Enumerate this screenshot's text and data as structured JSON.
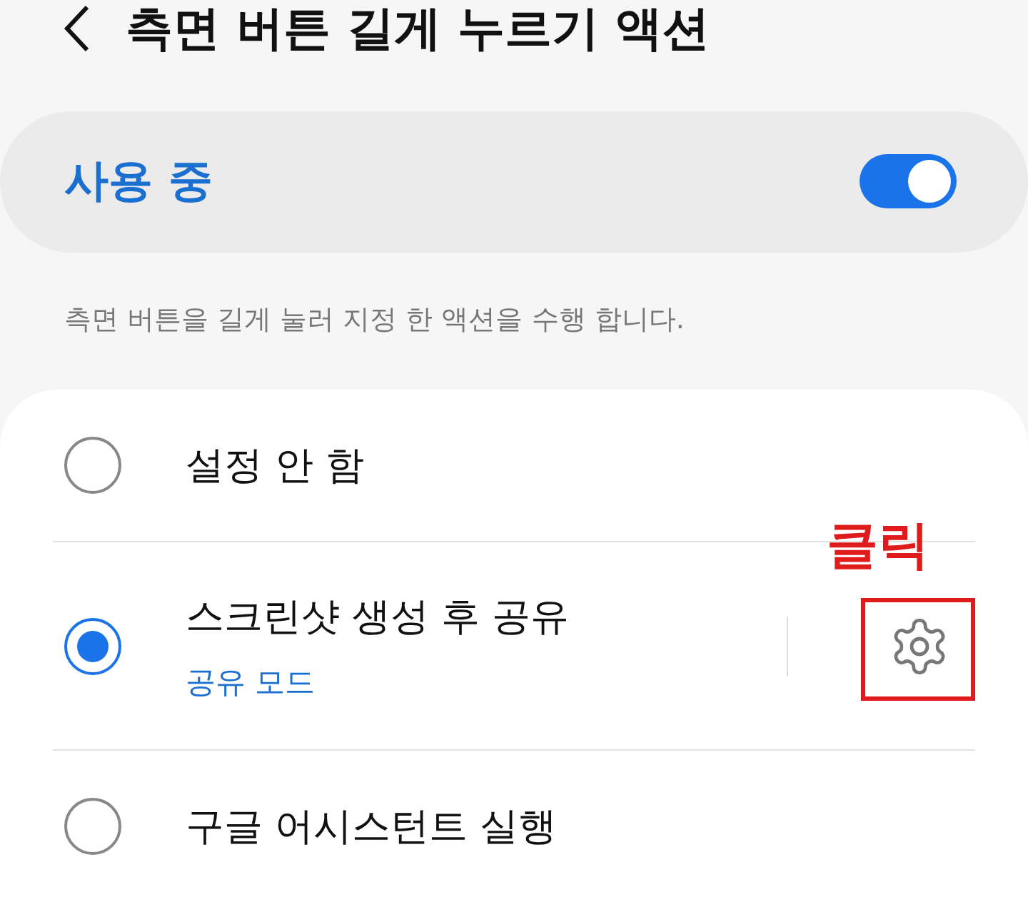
{
  "header": {
    "title": "측면 버튼 길게 누르기 액션"
  },
  "master_switch": {
    "label": "사용 중",
    "on": true
  },
  "description": "측면 버튼을 길게 눌러 지정 한 액션을 수행 합니다.",
  "options": [
    {
      "label": "설정 안 함",
      "selected": false
    },
    {
      "label": "스크린샷 생성 후 공유",
      "subtitle": "공유 모드",
      "selected": true,
      "has_settings": true
    },
    {
      "label": "구글 어시스턴트 실행",
      "selected": false
    }
  ],
  "annotation": {
    "text": "클릭"
  }
}
